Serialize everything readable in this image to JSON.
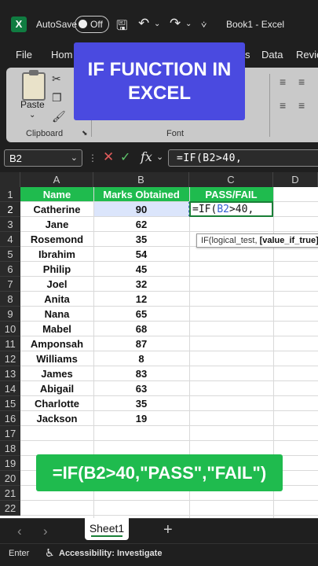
{
  "titlebar": {
    "logo_letter": "X",
    "autosave_label": "AutoSave",
    "autosave_state": "Off",
    "doc_title": "Book1  -  Excel"
  },
  "tabs": [
    "File",
    "Hom",
    "s",
    "Data",
    "Revie"
  ],
  "ribbon": {
    "paste_label": "Paste",
    "clipboard_label": "Clipboard",
    "font_label": "Font"
  },
  "banner": {
    "text": "IF FUNCTION IN\nEXCEL",
    "color": "#4a4ae0"
  },
  "formula_bar": {
    "name_box": "B2",
    "fx": "fx",
    "formula": "=IF(B2>40,"
  },
  "columns": [
    "A",
    "B",
    "C",
    "D"
  ],
  "rows": [
    "1",
    "2",
    "3",
    "4",
    "5",
    "6",
    "7",
    "8",
    "9",
    "10",
    "11",
    "12",
    "13",
    "14",
    "15",
    "16",
    "17",
    "18",
    "19",
    "20",
    "21",
    "22"
  ],
  "table": {
    "headers": [
      "Name",
      "Marks Obtained",
      "PASS/FAIL"
    ],
    "header_color": "#1fbb4e",
    "data": [
      [
        "Catherine",
        "90"
      ],
      [
        "Jane",
        "62"
      ],
      [
        "Rosemond",
        "35"
      ],
      [
        "Ibrahim",
        "54"
      ],
      [
        "Philip",
        "45"
      ],
      [
        "Joel",
        "32"
      ],
      [
        "Anita",
        "12"
      ],
      [
        "Nana",
        "65"
      ],
      [
        "Mabel",
        "68"
      ],
      [
        "Amponsah",
        "87"
      ],
      [
        "Williams",
        "8"
      ],
      [
        "James",
        "83"
      ],
      [
        "Abigail",
        "63"
      ],
      [
        "Charlotte",
        "35"
      ],
      [
        "Jackson",
        "19"
      ]
    ]
  },
  "editing_cell": {
    "prefix": "=IF(",
    "ref": "B2",
    "suffix": ">40,"
  },
  "tooltip": {
    "text": "IF(logical_test, ",
    "bold": "[value_if_true]"
  },
  "formula_banner": "=IF(B2>40,\"PASS\",\"FAIL\")",
  "sheet_tab": "Sheet1",
  "status": {
    "mode": "Enter",
    "accessibility": "Accessibility: Investigate"
  }
}
